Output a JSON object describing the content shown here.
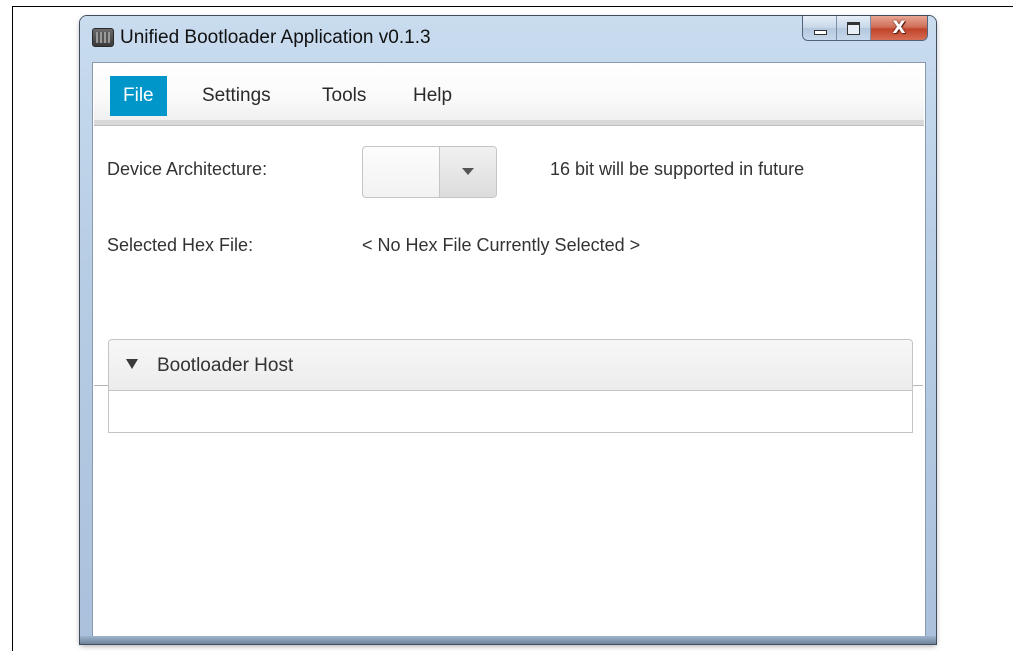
{
  "window": {
    "title": "Unified Bootloader Application v0.1.3",
    "close_glyph": "X",
    "app_icon": "chip-icon"
  },
  "menu": {
    "items": [
      {
        "label": "File",
        "active": true
      },
      {
        "label": "Settings",
        "active": false
      },
      {
        "label": "Tools",
        "active": false
      },
      {
        "label": "Help",
        "active": false
      }
    ]
  },
  "form": {
    "device_architecture_label": "Device Architecture:",
    "device_architecture_value": "",
    "architecture_note": "16 bit will be supported in future",
    "hex_file_label": "Selected Hex File:",
    "hex_file_value": "< No Hex File Currently Selected >"
  },
  "bootloader_host": {
    "title": "Bootloader Host",
    "expanded": true
  },
  "colors": {
    "menu_active": "#0096c9",
    "close_button": "#c0442b"
  }
}
